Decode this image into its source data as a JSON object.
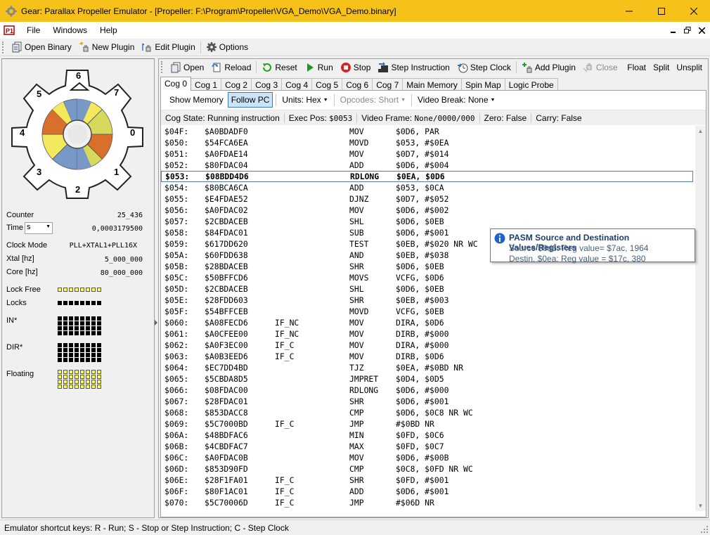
{
  "window": {
    "title": "Gear: Parallax Propeller Emulator - [Propeller: F:\\Program\\Propeller\\VGA_Demo\\VGA_Demo.binary]"
  },
  "menu": {
    "items": [
      {
        "label": "File"
      },
      {
        "label": "Windows"
      },
      {
        "label": "Help"
      }
    ]
  },
  "main_toolbar": {
    "open_binary": "Open Binary",
    "new_plugin": "New Plugin",
    "edit_plugin": "Edit Plugin",
    "options": "Options"
  },
  "left_panel": {
    "cog_numbers": [
      "0",
      "1",
      "2",
      "3",
      "4",
      "5",
      "6",
      "7"
    ],
    "counter_label": "Counter",
    "counter_value": "25_436",
    "time_label": "Time",
    "time_unit": "s",
    "time_value": "0,0003179500",
    "clock_mode_label": "Clock Mode",
    "clock_mode_value": "PLL+XTAL1+PLL16X",
    "xtal_label": "Xtal [hz]",
    "xtal_value": "5_000_000",
    "core_label": "Core [hz]",
    "core_value": "80_000_000",
    "lock_free_label": "Lock Free",
    "locks_label": "Locks",
    "in_label": "IN*",
    "dir_label": "DIR*",
    "floating_label": "Floating"
  },
  "propeller_toolbar": {
    "open": "Open",
    "reload": "Reload",
    "reset": "Reset",
    "run": "Run",
    "stop": "Stop",
    "step_instruction": "Step Instruction",
    "step_clock": "Step Clock",
    "add_plugin": "Add Plugin",
    "close": "Close",
    "float": "Float",
    "split": "Split",
    "unsplit": "Unsplit"
  },
  "tabs": [
    {
      "label": "Cog 0",
      "active": true
    },
    {
      "label": "Cog 1"
    },
    {
      "label": "Cog 2"
    },
    {
      "label": "Cog 3"
    },
    {
      "label": "Cog 4"
    },
    {
      "label": "Cog 5"
    },
    {
      "label": "Cog 6"
    },
    {
      "label": "Cog 7"
    },
    {
      "label": "Main Memory"
    },
    {
      "label": "Spin Map"
    },
    {
      "label": "Logic Probe"
    }
  ],
  "cog_toolbar": {
    "show_memory": "Show Memory",
    "follow_pc": "Follow PC",
    "units": "Units: Hex",
    "opcodes": "Opcodes: Short",
    "video_break": "Video Break: None"
  },
  "cog_status": {
    "cog_state_label": "Cog State:",
    "cog_state_value": "Running instruction",
    "exec_pos_label": "Exec Pos:",
    "exec_pos_value": "$0053",
    "video_frame_label": "Video Frame:",
    "video_frame_value": "None/0000/000",
    "zero_label": "Zero:",
    "zero_value": "False",
    "carry_label": "Carry:",
    "carry_value": "False"
  },
  "code_rows": [
    {
      "addr": "$04F:",
      "hex": "$A0BDADF0",
      "cond": "",
      "op": "MOV",
      "args": "$0D6, PAR"
    },
    {
      "addr": "$050:",
      "hex": "$54FCA6EA",
      "cond": "",
      "op": "MOVD",
      "args": "$053, #$0EA"
    },
    {
      "addr": "$051:",
      "hex": "$A0FDAE14",
      "cond": "",
      "op": "MOV",
      "args": "$0D7, #$014"
    },
    {
      "addr": "$052:",
      "hex": "$80FDAC04",
      "cond": "",
      "op": "ADD",
      "args": "$0D6, #$004"
    },
    {
      "addr": "$053:",
      "hex": "$08BDD4D6",
      "cond": "",
      "op": "RDLONG",
      "args": "$0EA, $0D6",
      "current": true
    },
    {
      "addr": "$054:",
      "hex": "$80BCA6CA",
      "cond": "",
      "op": "ADD",
      "args": "$053, $0CA"
    },
    {
      "addr": "$055:",
      "hex": "$E4FDAE52",
      "cond": "",
      "op": "DJNZ",
      "args": "$0D7, #$052"
    },
    {
      "addr": "$056:",
      "hex": "$A0FDAC02",
      "cond": "",
      "op": "MOV",
      "args": "$0D6, #$002"
    },
    {
      "addr": "$057:",
      "hex": "$2CBDACEB",
      "cond": "",
      "op": "SHL",
      "args": "$0D6, $0EB"
    },
    {
      "addr": "$058:",
      "hex": "$84FDAC01",
      "cond": "",
      "op": "SUB",
      "args": "$0D6, #$001"
    },
    {
      "addr": "$059:",
      "hex": "$617DD620",
      "cond": "",
      "op": "TEST",
      "args": "$0EB, #$020 NR WC"
    },
    {
      "addr": "$05A:",
      "hex": "$60FDD638",
      "cond": "",
      "op": "AND",
      "args": "$0EB, #$038"
    },
    {
      "addr": "$05B:",
      "hex": "$28BDACEB",
      "cond": "",
      "op": "SHR",
      "args": "$0D6, $0EB"
    },
    {
      "addr": "$05C:",
      "hex": "$50BFFCD6",
      "cond": "",
      "op": "MOVS",
      "args": "VCFG, $0D6"
    },
    {
      "addr": "$05D:",
      "hex": "$2CBDACEB",
      "cond": "",
      "op": "SHL",
      "args": "$0D6, $0EB"
    },
    {
      "addr": "$05E:",
      "hex": "$28FDD603",
      "cond": "",
      "op": "SHR",
      "args": "$0EB, #$003"
    },
    {
      "addr": "$05F:",
      "hex": "$54BFFCEB",
      "cond": "",
      "op": "MOVD",
      "args": "VCFG, $0EB"
    },
    {
      "addr": "$060:",
      "hex": "$A08FECD6",
      "cond": "IF_NC",
      "op": "MOV",
      "args": "DIRA, $0D6"
    },
    {
      "addr": "$061:",
      "hex": "$A0CFEE00",
      "cond": "IF_NC",
      "op": "MOV",
      "args": "DIRB, #$000"
    },
    {
      "addr": "$062:",
      "hex": "$A0F3EC00",
      "cond": "IF_C",
      "op": "MOV",
      "args": "DIRA, #$000"
    },
    {
      "addr": "$063:",
      "hex": "$A0B3EED6",
      "cond": "IF_C",
      "op": "MOV",
      "args": "DIRB, $0D6"
    },
    {
      "addr": "$064:",
      "hex": "$EC7DD4BD",
      "cond": "",
      "op": "TJZ",
      "args": "$0EA, #$0BD NR"
    },
    {
      "addr": "$065:",
      "hex": "$5CBDA8D5",
      "cond": "",
      "op": "JMPRET",
      "args": "$0D4, $0D5"
    },
    {
      "addr": "$066:",
      "hex": "$08FDAC00",
      "cond": "",
      "op": "RDLONG",
      "args": "$0D6, #$000"
    },
    {
      "addr": "$067:",
      "hex": "$28FDAC01",
      "cond": "",
      "op": "SHR",
      "args": "$0D6, #$001"
    },
    {
      "addr": "$068:",
      "hex": "$853DACC8",
      "cond": "",
      "op": "CMP",
      "args": "$0D6, $0C8 NR WC"
    },
    {
      "addr": "$069:",
      "hex": "$5C7000BD",
      "cond": "IF_C",
      "op": "JMP",
      "args": "#$0BD NR"
    },
    {
      "addr": "$06A:",
      "hex": "$48BDFAC6",
      "cond": "",
      "op": "MIN",
      "args": "$0FD, $0C6"
    },
    {
      "addr": "$06B:",
      "hex": "$4CBDFAC7",
      "cond": "",
      "op": "MAX",
      "args": "$0FD, $0C7"
    },
    {
      "addr": "$06C:",
      "hex": "$A0FDAC0B",
      "cond": "",
      "op": "MOV",
      "args": "$0D6, #$00B"
    },
    {
      "addr": "$06D:",
      "hex": "$853D90FD",
      "cond": "",
      "op": "CMP",
      "args": "$0C8, $0FD NR WC"
    },
    {
      "addr": "$06E:",
      "hex": "$28F1FA01",
      "cond": "IF_C",
      "op": "SHR",
      "args": "$0FD, #$001"
    },
    {
      "addr": "$06F:",
      "hex": "$80F1AC01",
      "cond": "IF_C",
      "op": "ADD",
      "args": "$0D6, #$001"
    },
    {
      "addr": "$070:",
      "hex": "$5C70006D",
      "cond": "IF_C",
      "op": "JMP",
      "args": "#$06D NR"
    }
  ],
  "tooltip": {
    "title": "PASM Source and Destination Values/Registers",
    "source": "Source $0d6: Reg value= $7ac, 1964",
    "destin": "Destin. $0ea: Reg value = $17c, 380"
  },
  "statusbar": {
    "text": "Emulator shortcut keys:  R - Run; S - Stop or Step Instruction; C - Step Clock"
  },
  "colors": {
    "titlebar": "#f6c21a",
    "cog_yellow": "#f2ea5c",
    "cog_orange": "#d8702c",
    "cog_blue": "#7898c8",
    "cog_olive": "#d6d95a"
  }
}
